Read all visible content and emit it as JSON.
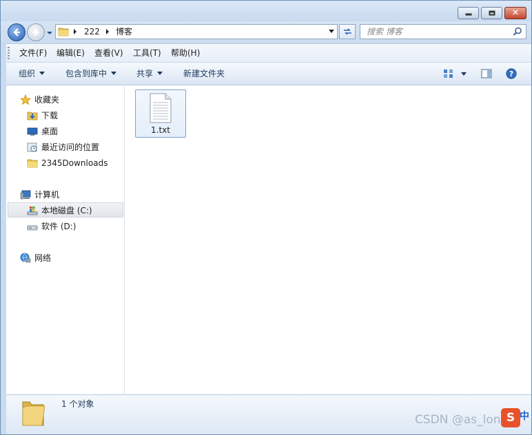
{
  "window": {
    "controls": {
      "close_glyph": "✕"
    }
  },
  "navbar": {
    "breadcrumbs": [
      "222",
      "博客"
    ],
    "search_placeholder": "搜索 博客"
  },
  "menubar": {
    "items": [
      "文件(F)",
      "编辑(E)",
      "查看(V)",
      "工具(T)",
      "帮助(H)"
    ]
  },
  "commandbar": {
    "organize": "组织",
    "include_in_library": "包含到库中",
    "share": "共享",
    "new_folder": "新建文件夹",
    "icons": [
      "views-icon",
      "preview-pane-icon",
      "help-icon"
    ]
  },
  "navpane": {
    "favorites": {
      "header": "收藏夹",
      "items": [
        "下载",
        "桌面",
        "最近访问的位置",
        "2345Downloads"
      ]
    },
    "computer": {
      "header": "计算机",
      "items": [
        "本地磁盘 (C:)",
        "软件 (D:)"
      ],
      "selected": "本地磁盘 (C:)"
    },
    "network": {
      "header": "网络"
    }
  },
  "content": {
    "files": [
      {
        "name": "1.txt",
        "type": "text-file"
      }
    ]
  },
  "details": {
    "count_text": "1 个对象"
  },
  "overlay": {
    "watermark": "CSDN @as_long_",
    "ime_logo": "S",
    "ime_mode": "中"
  },
  "colors": {
    "accent": "#2a62b8",
    "selection_border": "#7da2ce",
    "toolbar_text": "#1e395b"
  }
}
